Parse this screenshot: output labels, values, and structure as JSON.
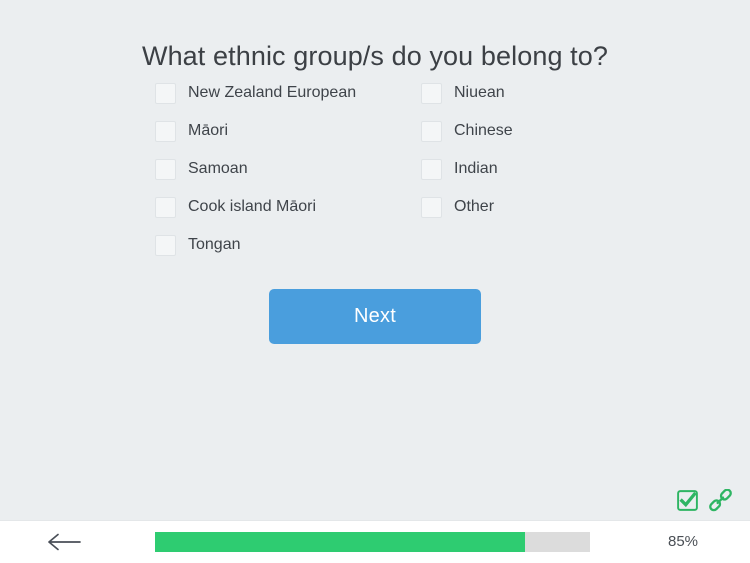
{
  "question": {
    "title": "What ethnic group/s do you belong to?"
  },
  "options": {
    "left_column": [
      {
        "label": "New Zealand European",
        "checked": false
      },
      {
        "label": "Māori",
        "checked": false
      },
      {
        "label": "Samoan",
        "checked": false
      },
      {
        "label": "Cook island Māori",
        "checked": false
      },
      {
        "label": "Tongan",
        "checked": false
      }
    ],
    "right_column": [
      {
        "label": "Niuean",
        "checked": false
      },
      {
        "label": "Chinese",
        "checked": false
      },
      {
        "label": "Indian",
        "checked": false
      },
      {
        "label": "Other",
        "checked": false
      }
    ]
  },
  "actions": {
    "next_label": "Next"
  },
  "status_icons": [
    {
      "name": "checkbox-check-icon"
    },
    {
      "name": "link-chain-icon"
    }
  ],
  "bottom_bar": {
    "back_icon": "arrow-left-icon",
    "progress_percent_label": "85%",
    "progress_value": 85
  },
  "colors": {
    "background": "#ebeef0",
    "bottom_bar": "#ffffff",
    "accent_blue": "#4a9edd",
    "progress_green": "#2ecc71",
    "progress_track": "#dcdcdc",
    "status_icon_green": "#2eb563",
    "text_primary": "#3c4045",
    "checkbox_border": "#dfe3e6"
  }
}
